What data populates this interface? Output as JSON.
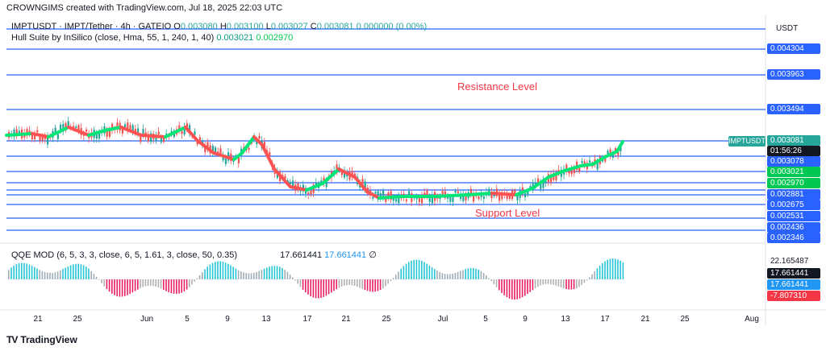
{
  "credit": "CROWNGIMS created with TradingView.com, Jul 18, 2025 22:03 UTC",
  "symbol_line": {
    "name": "IMPTUSDT · IMPT/Tether · 4h · GATEIO",
    "o_label": "O",
    "o": "0.003080",
    "h_label": "H",
    "h": "0.003100",
    "l_label": "L",
    "l": "0.003027",
    "c_label": "C",
    "c": "0.003081",
    "chg": "0.000000 (0.00%)"
  },
  "indicator": {
    "name": "Hull Suite by InSilico (close, Hma, 55, 1, 240, 1, 40)",
    "v1": "0.003021",
    "v2": "0.002970"
  },
  "qqe": {
    "name": "QQE MOD (6, 5, 3, 3, close, 6, 5, 1.61, 3, close, 50, 0.35)",
    "v1": "17.661441",
    "v2": "17.661441",
    "eye": "∅"
  },
  "currency": "USDT",
  "price_tag": {
    "symbol": "IMPTUSDT",
    "price": "0.003081",
    "countdown": "01:56:26"
  },
  "price_labels": {
    "l1": "0.004304",
    "l2": "0.003963",
    "l3": "0.003494",
    "l4": "0.003078",
    "l5": "0.003021",
    "l6": "0.002970",
    "l7": "0.002881",
    "l8": "0.002675",
    "l9": "0.002531",
    "l10": "0.002436",
    "l11": "0.002346"
  },
  "qqe_labels": {
    "top": "22.165487",
    "a": "17.661441",
    "b": "17.661441",
    "neg": "-7.807310"
  },
  "annotations": {
    "resistance": "Resistance Level",
    "support": "Support Level"
  },
  "x_ticks": [
    "21",
    "25",
    "Jun",
    "5",
    "9",
    "13",
    "17",
    "21",
    "25",
    "Jul",
    "5",
    "9",
    "13",
    "17",
    "21",
    "25",
    "Aug"
  ],
  "brand": "TradingView",
  "colors": {
    "level_line": "#2962ff",
    "hull_up": "#00e676",
    "hull_down": "#ff5252",
    "bull": "#26a69a",
    "bear": "#ef5350"
  }
}
